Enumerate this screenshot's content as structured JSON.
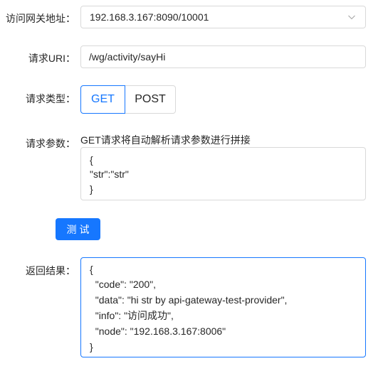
{
  "form": {
    "gateway": {
      "label": "访问网关地址：",
      "value": "192.168.3.167:8090/10001"
    },
    "uri": {
      "label": "请求URI：",
      "value": "/wg/activity/sayHi"
    },
    "method": {
      "label": "请求类型：",
      "options": [
        "GET",
        "POST"
      ],
      "selected": "GET"
    },
    "params": {
      "label": "请求参数：",
      "hint": "GET请求将自动解析请求参数进行拼接",
      "lines": [
        "{",
        "\"str\":\"str\"",
        "}"
      ]
    },
    "submit_label": "测试"
  },
  "result": {
    "label": "返回结果：",
    "lines": [
      "{",
      "  \"code\": \"200\",",
      "  \"data\": \"hi str by api-gateway-test-provider\",",
      "  \"info\": \"访问成功\",",
      "  \"node\": \"192.168.3.167:8006\"",
      "}"
    ]
  },
  "colors": {
    "accent": "#1677ff",
    "border": "#d9d9d9",
    "text": "#262626"
  },
  "icons": {
    "select_arrow": "chevron-down-icon"
  }
}
